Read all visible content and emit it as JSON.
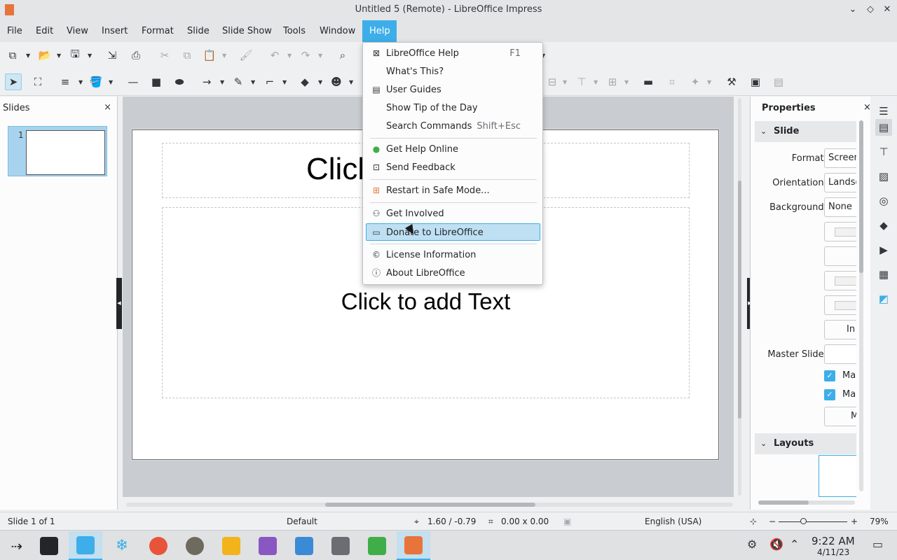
{
  "window": {
    "title": "Untitled 5 (Remote) - LibreOffice Impress",
    "minimize": "⌄",
    "maximize": "◇",
    "close": "✕"
  },
  "menubar": {
    "items": [
      "File",
      "Edit",
      "View",
      "Insert",
      "Format",
      "Slide",
      "Slide Show",
      "Tools",
      "Window",
      "Help"
    ],
    "active": "Help"
  },
  "help_menu": {
    "items": [
      {
        "label": "LibreOffice Help",
        "shortcut": "F1",
        "icon": "help-book-icon"
      },
      {
        "label": "What's This?",
        "shortcut": "",
        "icon": ""
      },
      {
        "label": "User Guides",
        "shortcut": "",
        "icon": "document-icon"
      },
      {
        "label": "Show Tip of the Day",
        "shortcut": "",
        "icon": ""
      },
      {
        "label": "Search Commands",
        "shortcut": "Shift+Esc",
        "icon": ""
      },
      {
        "label": "Get Help Online",
        "shortcut": "",
        "icon": "globe-icon"
      },
      {
        "label": "Send Feedback",
        "shortcut": "",
        "icon": "feedback-icon"
      },
      {
        "label": "Restart in Safe Mode...",
        "shortcut": "",
        "icon": "safe-mode-icon"
      },
      {
        "label": "Get Involved",
        "shortcut": "",
        "icon": "people-icon"
      },
      {
        "label": "Donate to LibreOffice",
        "shortcut": "",
        "icon": "donate-icon"
      },
      {
        "label": "License Information",
        "shortcut": "",
        "icon": "copyright-icon"
      },
      {
        "label": "About LibreOffice",
        "shortcut": "",
        "icon": "info-icon"
      }
    ],
    "highlighted": "Donate to LibreOffice"
  },
  "slides_panel": {
    "title": "Slides",
    "close": "×",
    "thumbnails": [
      {
        "number": "1"
      }
    ]
  },
  "slide": {
    "title_placeholder": "Click to add Title",
    "title_visible": "Click",
    "body_placeholder": "Click to add Text"
  },
  "properties": {
    "title": "Properties",
    "close": "×",
    "menu_icon": "hamburger-icon",
    "section_slide": "Slide",
    "format_label": "Format:",
    "format_value": "Screen",
    "orientation_label": "Orientation:",
    "orientation_value": "Landsc",
    "background_label": "Background:",
    "background_value": "None",
    "insert_image_label": "In",
    "master_slide_label": "Master Slide:",
    "master_check1": "Ma",
    "master_check2": "Ma",
    "master_button": "M",
    "section_layouts": "Layouts"
  },
  "statusbar": {
    "slide_info": "Slide 1 of 1",
    "layout": "Default",
    "position": "1.60 / -0.79",
    "size": "0.00 x 0.00",
    "language": "English (USA)",
    "zoom_minus": "−",
    "zoom_plus": "+",
    "zoom": "79%",
    "zoom_level": 0.36
  },
  "taskbar": {
    "time": "9:22 AM",
    "date": "4/11/23"
  },
  "colors": {
    "accent": "#3daee9",
    "impress": "#e8743b",
    "writer": "#3b8ad6",
    "calc": "#3fae49",
    "base": "#8a57c2",
    "draw": "#f3b31c"
  }
}
